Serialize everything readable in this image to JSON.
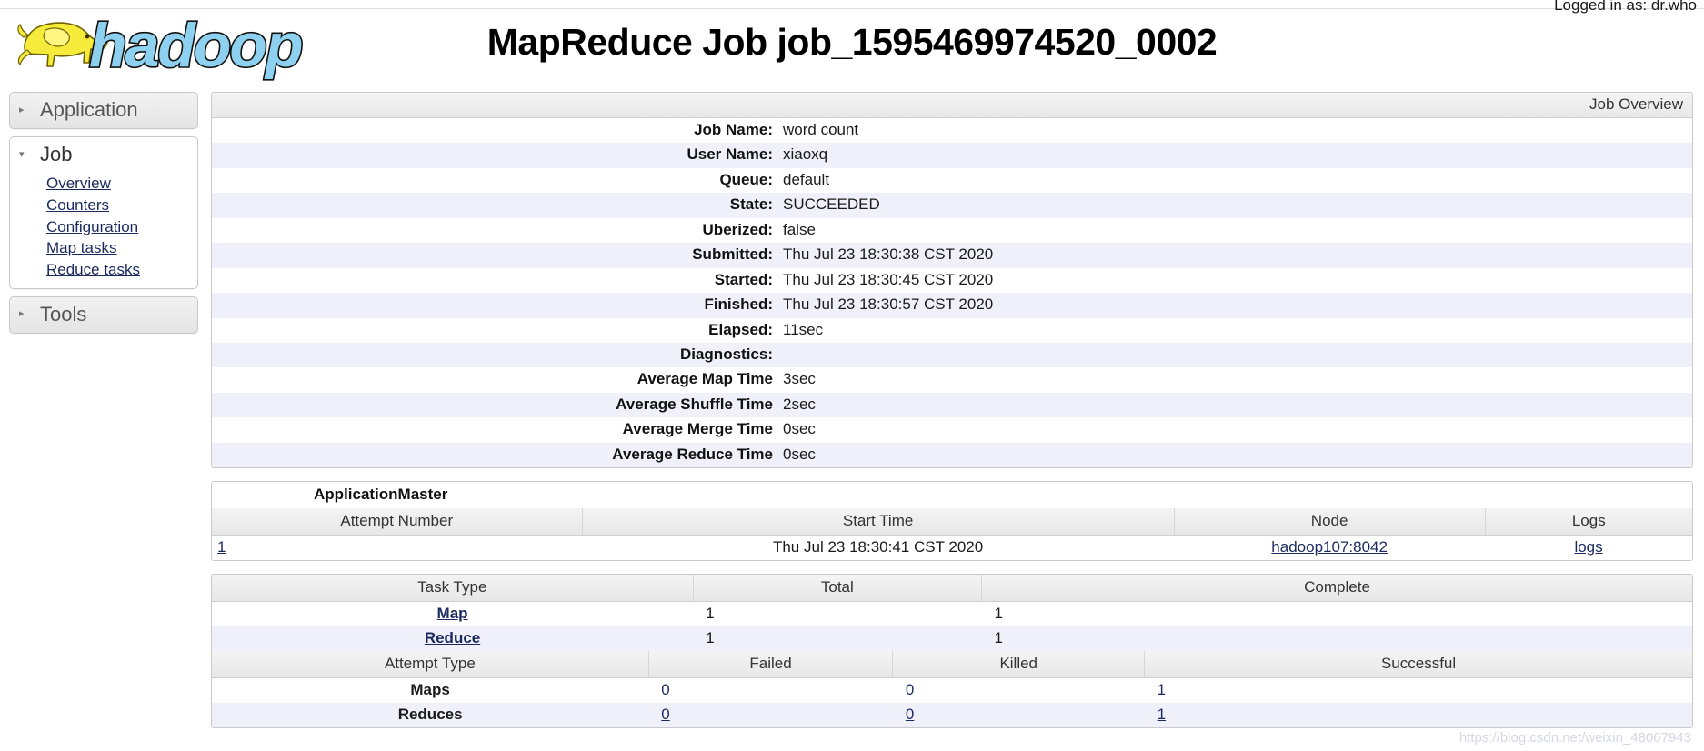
{
  "topbar": {
    "logged_in_label": "Logged in as: dr.who"
  },
  "header": {
    "logo_alt": "hadoop-logo",
    "title": "MapReduce Job job_1595469974520_0002"
  },
  "sidebar": {
    "sections": [
      {
        "label": "Application",
        "state": "collapsed",
        "arrow": "▸",
        "items": []
      },
      {
        "label": "Job",
        "state": "expanded",
        "arrow": "▾",
        "items": [
          {
            "label": "Overview"
          },
          {
            "label": "Counters"
          },
          {
            "label": "Configuration"
          },
          {
            "label": "Map tasks"
          },
          {
            "label": "Reduce tasks"
          }
        ]
      },
      {
        "label": "Tools",
        "state": "collapsed",
        "arrow": "▸",
        "items": []
      }
    ]
  },
  "job_overview": {
    "caption": "Job Overview",
    "rows": [
      {
        "key": "Job Name:",
        "value": "word count"
      },
      {
        "key": "User Name:",
        "value": "xiaoxq"
      },
      {
        "key": "Queue:",
        "value": "default"
      },
      {
        "key": "State:",
        "value": "SUCCEEDED"
      },
      {
        "key": "Uberized:",
        "value": "false"
      },
      {
        "key": "Submitted:",
        "value": "Thu Jul 23 18:30:38 CST 2020"
      },
      {
        "key": "Started:",
        "value": "Thu Jul 23 18:30:45 CST 2020"
      },
      {
        "key": "Finished:",
        "value": "Thu Jul 23 18:30:57 CST 2020"
      },
      {
        "key": "Elapsed:",
        "value": "11sec"
      },
      {
        "key": "Diagnostics:",
        "value": ""
      },
      {
        "key": "Average Map Time",
        "value": "3sec"
      },
      {
        "key": "Average Shuffle Time",
        "value": "2sec"
      },
      {
        "key": "Average Merge Time",
        "value": "0sec"
      },
      {
        "key": "Average Reduce Time",
        "value": "0sec"
      }
    ]
  },
  "application_master": {
    "title": "ApplicationMaster",
    "columns": [
      "Attempt Number",
      "Start Time",
      "Node",
      "Logs"
    ],
    "rows": [
      {
        "attempt_number": "1",
        "start_time": "Thu Jul 23 18:30:41 CST 2020",
        "node": "hadoop107:8042",
        "logs": "logs"
      }
    ]
  },
  "task_summary": {
    "columns": [
      "Task Type",
      "Total",
      "Complete"
    ],
    "rows": [
      {
        "task_type": "Map",
        "total": "1",
        "complete": "1"
      },
      {
        "task_type": "Reduce",
        "total": "1",
        "complete": "1"
      }
    ],
    "attempt_columns": [
      "Attempt Type",
      "Failed",
      "Killed",
      "Successful"
    ],
    "attempt_rows": [
      {
        "attempt_type": "Maps",
        "failed": "0",
        "killed": "0",
        "successful": "1"
      },
      {
        "attempt_type": "Reduces",
        "failed": "0",
        "killed": "0",
        "successful": "1"
      }
    ]
  },
  "watermark": {
    "text": "https://blog.csdn.net/weixin_48067943"
  }
}
